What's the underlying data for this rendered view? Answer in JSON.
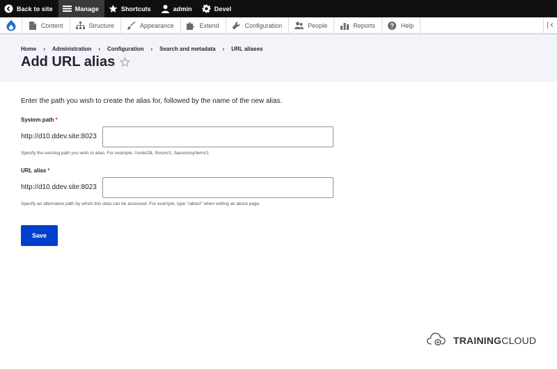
{
  "toolbar": {
    "back_to_site": "Back to site",
    "manage": "Manage",
    "shortcuts": "Shortcuts",
    "user": "admin",
    "devel": "Devel"
  },
  "tray": {
    "items": [
      "Content",
      "Structure",
      "Appearance",
      "Extend",
      "Configuration",
      "People",
      "Reports",
      "Help"
    ]
  },
  "breadcrumb": {
    "items": [
      "Home",
      "Administration",
      "Configuration",
      "Search and metadata",
      "URL aliases"
    ],
    "separator": "›"
  },
  "page": {
    "title": "Add URL alias",
    "intro": "Enter the path you wish to create the alias for, followed by the name of the new alias."
  },
  "form": {
    "system_path": {
      "label": "System path",
      "required_mark": "*",
      "prefix": "http://d10.ddev.site:8023",
      "value": "",
      "description": "Specify the existing path you wish to alias. For example: /node/28, /forum/1, /taxonomy/term/1."
    },
    "url_alias": {
      "label": "URL alias",
      "required_mark": "*",
      "prefix": "http://d10.ddev.site:8023",
      "value": "",
      "description": "Specify an alternative path by which this data can be accessed. For example, type \"/about\" when writing an about page."
    },
    "save_label": "Save"
  },
  "watermark": {
    "part1": "TRAINING",
    "part2": "CLOUD"
  },
  "colors": {
    "toolbar_bg": "#0f0f0f",
    "accent": "#003ecc",
    "required": "#dc2323",
    "header_bg": "#f3f4f9"
  }
}
